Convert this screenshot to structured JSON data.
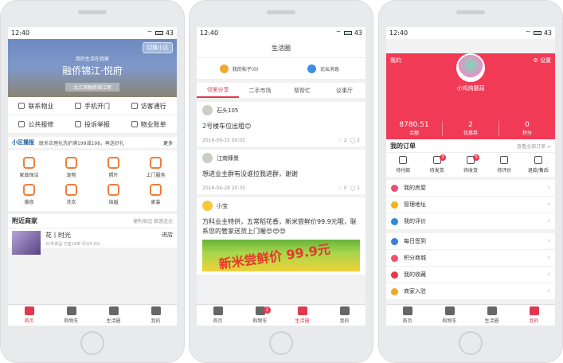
{
  "status": {
    "time": "12:40",
    "battery": "43"
  },
  "tabbar": [
    {
      "label": "首页"
    },
    {
      "label": "购物车",
      "badge": "1"
    },
    {
      "label": "生活圈"
    },
    {
      "label": "我的"
    }
  ],
  "screen1": {
    "switch_label": "切换小区",
    "hero_sub": "我的生活在我家",
    "hero_title": "融侨锦江·悦府",
    "hero_addr": "北江滨融侨锦江畔",
    "actions": [
      "联系物业",
      "手机开门",
      "访客通行",
      "公共报修",
      "投诉举报",
      "物业账单"
    ],
    "notice_title": "小区播报",
    "notice_text": "联系合理化洗护满199减198，再送好礼",
    "notice_more": "更多",
    "services": [
      "家政保洁",
      "宠物",
      "照片",
      "上门服务",
      "维修",
      "洗衣",
      "结婚",
      "家装"
    ],
    "nearby_title": "附近商家",
    "nearby_tags": "便利周边 极速送达",
    "shop": {
      "name": "花丨时光",
      "meta": "21件商品 已售18单 评分0.0分",
      "enter": "进店"
    }
  },
  "screen2": {
    "title": "生活圈",
    "my_posts": "我的帖子(0)",
    "forum_msg": "论坛消息",
    "tabs": [
      "邻里分享",
      "二手市场",
      "帮帮忙",
      "议事厅"
    ],
    "posts": [
      {
        "user": "石头105",
        "text": "2号楼车位出租😊",
        "date": "2016-09-15 00:05",
        "likes": "2",
        "comments": "2"
      },
      {
        "user": "江南臻景",
        "text": "想进业主群有没谁拉我进群，谢谢",
        "date": "2016-04-28 20:35",
        "likes": "0",
        "comments": "1"
      },
      {
        "user": "小宝",
        "text": "万科业主特供，五常稻花香，新米尝鲜价99.9元哦，联系您的管家送货上门喔😍😍😍",
        "image_text": "新米尝鲜价 99.9元"
      }
    ]
  },
  "screen3": {
    "mine": "我的",
    "settings": "设置",
    "username": "小鸡炖蘑菇",
    "stats": [
      {
        "value": "8780.51",
        "label": "余额"
      },
      {
        "value": "2",
        "label": "优惠券"
      },
      {
        "value": "0",
        "label": "积分"
      }
    ],
    "orders_title": "我的订单",
    "orders_all": "查看全部订单 >",
    "order_items": [
      {
        "label": "待付款"
      },
      {
        "label": "待发货",
        "badge": "3"
      },
      {
        "label": "待收货",
        "badge": "5"
      },
      {
        "label": "待评价"
      },
      {
        "label": "退款/售后"
      }
    ],
    "menu1": [
      {
        "label": "我的房屋",
        "color": "#e94d73"
      },
      {
        "label": "管理地址",
        "color": "#f2b21b"
      },
      {
        "label": "我的评价",
        "color": "#2e8be0"
      }
    ],
    "menu2": [
      {
        "label": "每日签到",
        "color": "#3b7fd9"
      },
      {
        "label": "积分商城",
        "color": "#f05070"
      },
      {
        "label": "我的收藏",
        "color": "#e9384c"
      },
      {
        "label": "商家入驻",
        "color": "#f2a62a"
      }
    ]
  }
}
